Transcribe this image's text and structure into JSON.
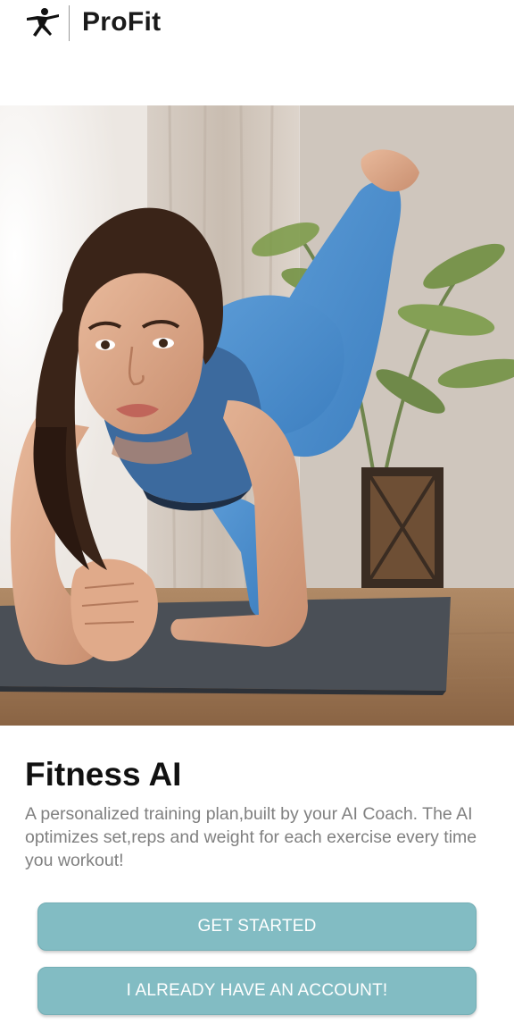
{
  "header": {
    "logo_icon": "yoga-pose-icon",
    "brand": "ProFit"
  },
  "hero": {
    "image_subject": "woman-plank-exercise-photo"
  },
  "content": {
    "title": "Fitness AI",
    "description": "A personalized training plan,built by your AI Coach. The AI optimizes set,reps and weight for each exercise every time you workout!"
  },
  "actions": {
    "get_started": "GET STARTED",
    "have_account": "I ALREADY HAVE AN ACCOUNT!"
  },
  "colors": {
    "button": "#82bcc3",
    "button_text": "#ffffff",
    "title": "#111111",
    "description": "#808080"
  }
}
